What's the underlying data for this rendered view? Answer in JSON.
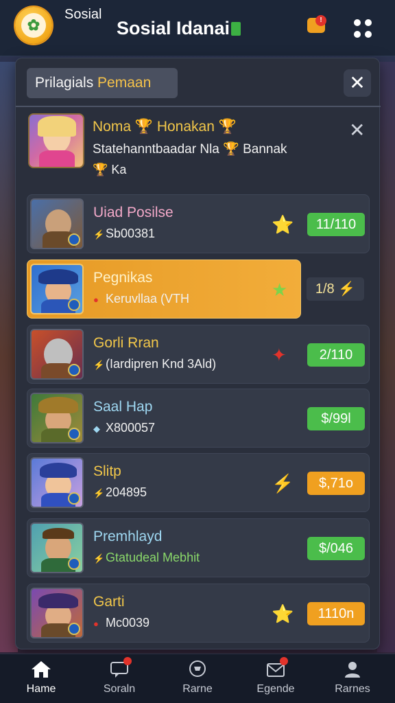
{
  "header": {
    "small_title": "Sosial",
    "title": "Sosial Idanai"
  },
  "panel": {
    "tab_label_1": "Prilagials ",
    "tab_label_2": "Pemaan",
    "close_label": "✕"
  },
  "featured": {
    "title": "Noma 🏆 Honakan 🏆",
    "subtitle": "Statehanntbaadar Nla 🏆 Bannak",
    "subtitle2": "🏆 Ka",
    "dismiss_label": "✕"
  },
  "rows": [
    {
      "name": "Uiad Posilse",
      "meta": "Sb00381",
      "meta_icon": "⚡",
      "star": "⭐",
      "score": "11/110",
      "score_style": "green",
      "name_color": "#f3a9c9"
    },
    {
      "name": "Pegnikas",
      "meta": "Keruvllaa (VTH",
      "meta_icon": "●",
      "star": "★",
      "score": "1/8 ⚡",
      "score_style": "dark",
      "name_color": "#fff2c9"
    },
    {
      "name": "Gorli Rran",
      "meta": "(Iardipren Knd 3Ald)",
      "meta_icon": "⚡",
      "star": "✦",
      "score": "2/110",
      "score_style": "green",
      "name_color": "#f2c74a"
    },
    {
      "name": "Saal Hap",
      "meta": "X800057",
      "meta_icon": "◆",
      "star": "",
      "score": "$/99l",
      "score_style": "green",
      "name_color": "#9fd8f2"
    },
    {
      "name": "Slitp",
      "meta": "204895",
      "meta_icon": "⚡",
      "star": "⚡",
      "score": "$,71o",
      "score_style": "orange",
      "name_color": "#f2c74a"
    },
    {
      "name": "Premhlayd",
      "meta": "Gtatudeal Mebhit",
      "meta_icon": "⚡",
      "star": "",
      "score": "$/046",
      "score_style": "green",
      "name_color": "#9fd8f2"
    },
    {
      "name": "Garti",
      "meta": "Mc0039",
      "meta_icon": "●",
      "star": "⭐",
      "score": "1110n",
      "score_style": "orange",
      "name_color": "#f2c74a"
    }
  ],
  "nav": [
    {
      "label": "Hame",
      "icon": "home-icon"
    },
    {
      "label": "Soraln",
      "icon": "chat-icon"
    },
    {
      "label": "Rarne",
      "icon": "trophy-icon"
    },
    {
      "label": "Egende",
      "icon": "mail-icon"
    },
    {
      "label": "Rarnes",
      "icon": "profile-icon"
    }
  ],
  "colors": {
    "accent": "#f0a020",
    "green": "#4bbd4b",
    "panel": "#2a2f3c"
  }
}
